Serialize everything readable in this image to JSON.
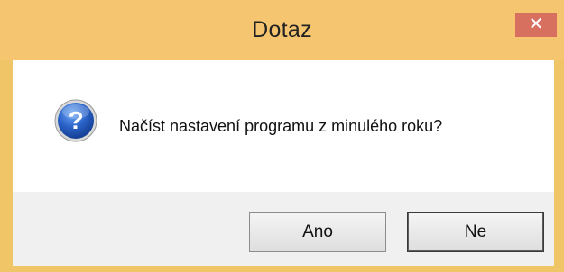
{
  "window": {
    "title": "Dotaz",
    "close_glyph": "✕"
  },
  "message": {
    "icon": "question-icon",
    "text": "Načíst nastavení programu z minulého roku?"
  },
  "buttons": {
    "yes_label": "Ano",
    "no_label": "Ne"
  },
  "colors": {
    "titlebar": "#f6c570",
    "close_button": "#d8705f",
    "button_area": "#f0f0f0",
    "icon_blue": "#1f55b5"
  }
}
